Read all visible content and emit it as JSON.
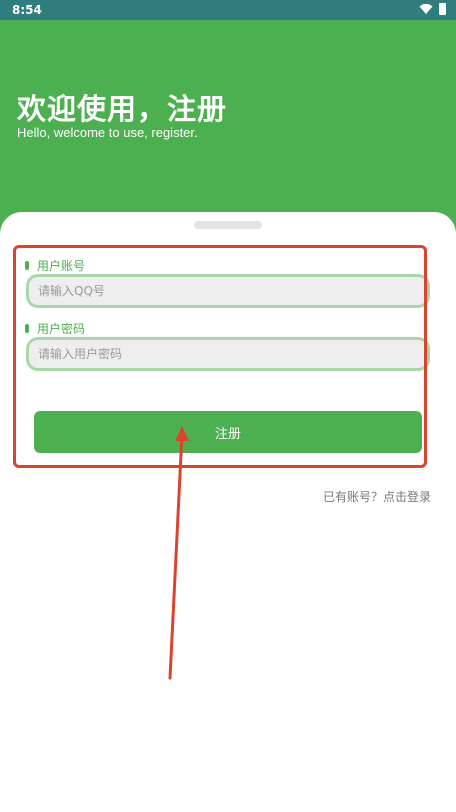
{
  "status_bar": {
    "time": "8:54",
    "wifi_icon": "wifi-icon",
    "battery_icon": "battery-icon"
  },
  "header": {
    "title": "欢迎使用，注册",
    "subtitle": "Hello, welcome to use, register."
  },
  "form": {
    "account_label": "用户账号",
    "account_placeholder": "请输入QQ号",
    "account_value": "",
    "password_label": "用户密码",
    "password_placeholder": "请输入用户密码",
    "password_value": "",
    "register_label": "注册"
  },
  "footer": {
    "login_link": "已有账号？点击登录"
  },
  "colors": {
    "primary": "#4cb050",
    "status_bar": "#2f7d7c",
    "annotation": "#d9442c",
    "input_border": "#a9d8a7"
  }
}
